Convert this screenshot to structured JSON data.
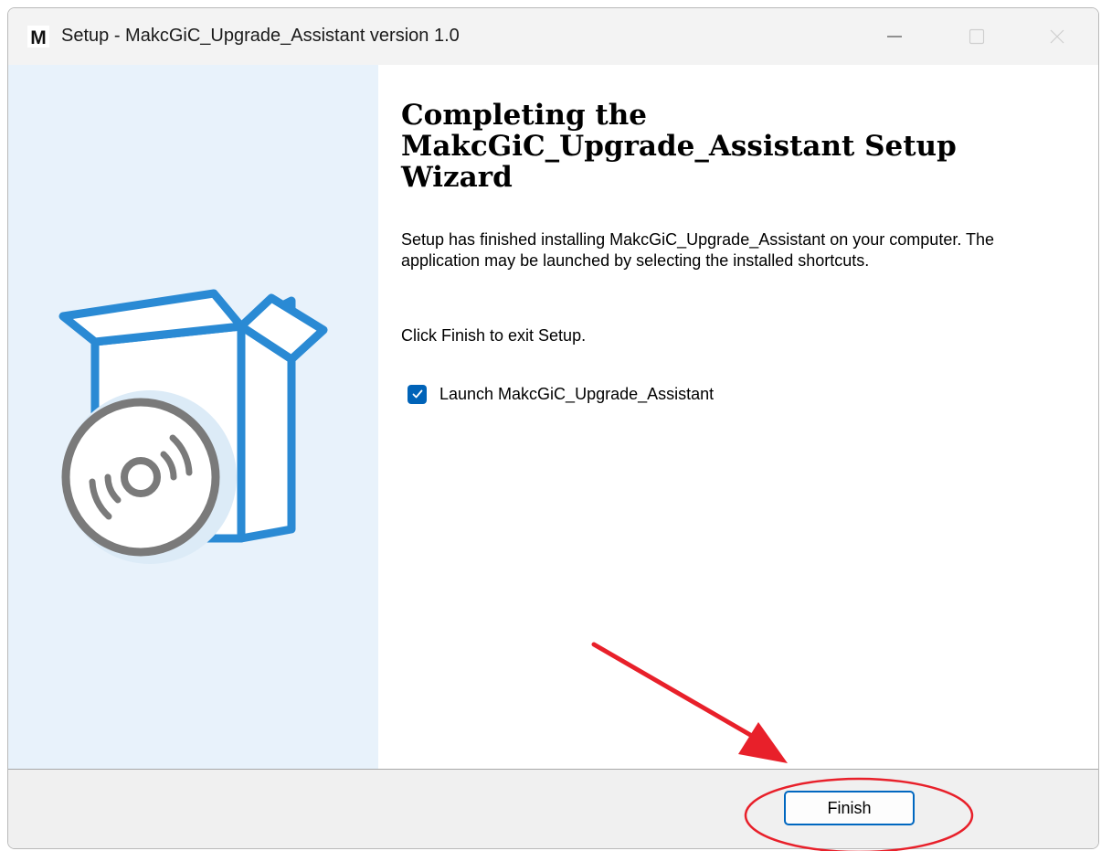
{
  "window": {
    "title": "Setup - MakcGiC_Upgrade_Assistant version 1.0",
    "app_icon_letter": "M"
  },
  "content": {
    "heading": "Completing the MakcGiC_Upgrade_Assistant Setup Wizard",
    "description": "Setup has finished installing MakcGiC_Upgrade_Assistant on your computer. The application may be launched by selecting the installed shortcuts.",
    "finish_note": "Click Finish to exit Setup.",
    "launch_checkbox": {
      "label": "Launch MakcGiC_Upgrade_Assistant",
      "checked": true
    }
  },
  "footer": {
    "finish_label": "Finish"
  },
  "colors": {
    "accent": "#0063b8",
    "side_panel": "#e8f2fb",
    "box_blue": "#2a8ad4",
    "annotation_red": "#e8202a"
  },
  "icons": {
    "sidebar_art": "installer-box-with-disc",
    "annotation": "red-arrow-and-circle"
  }
}
